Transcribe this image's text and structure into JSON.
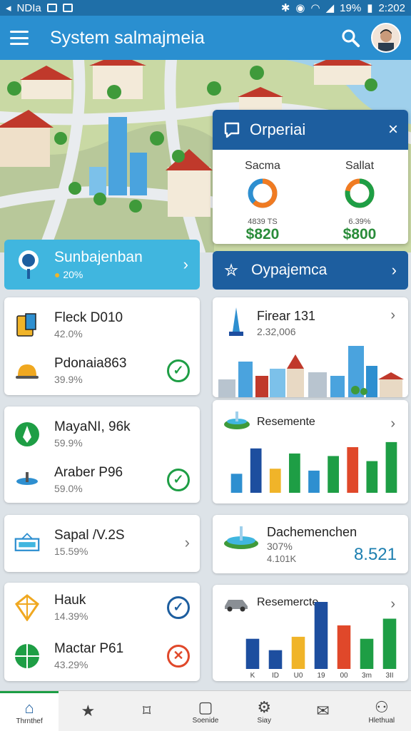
{
  "status_bar": {
    "carrier": "NDIa",
    "battery": "19%",
    "time": "2:202"
  },
  "app_bar": {
    "title": "System salmajmeia"
  },
  "popup": {
    "title": "Orperiai",
    "close": "×",
    "left": {
      "label": "Sacma",
      "sub": "4839 TS",
      "value": "$820",
      "ring_fraction": 0.62
    },
    "right": {
      "label": "Sallat",
      "sub": "6.39%",
      "value": "$800",
      "ring_fraction": 0.78
    }
  },
  "banner_left": {
    "title": "Sunbajenban",
    "sub": "20%"
  },
  "banner_right": {
    "title": "Oypajemca"
  },
  "left_cards": [
    {
      "rows": [
        {
          "name": "Fleck D010",
          "pct": "42.0%",
          "icon": "calculator-icon"
        },
        {
          "name": "Pdonaia863",
          "pct": "39.9%",
          "icon": "bell-icon",
          "status": "✓"
        }
      ]
    },
    {
      "rows": [
        {
          "name": "MayaNI, 96k",
          "pct": "59.9%",
          "icon": "leaf-icon"
        },
        {
          "name": "Araber P96",
          "pct": "59.0%",
          "icon": "fountain-icon",
          "status": "✓"
        }
      ]
    },
    {
      "rows": [
        {
          "name": "Sapal /V.2S",
          "pct": "15.59%",
          "icon": "sign-icon"
        }
      ]
    },
    {
      "rows": [
        {
          "name": "Hauk",
          "pct": "14.39%",
          "icon": "kite-icon",
          "status": "✓"
        },
        {
          "name": "Mactar P61",
          "pct": "43.29%",
          "icon": "globe-icon",
          "status": "✕"
        }
      ]
    }
  ],
  "right_cards": {
    "city": {
      "title": "Firear 131",
      "sub": "2.32,006"
    },
    "chart1": {
      "title": "Resemente",
      "chart_data": {
        "type": "bar",
        "values": [
          3,
          7,
          3.8,
          6.2,
          3.5,
          5.8,
          7.2,
          5,
          8
        ],
        "colors": [
          "#2e8fd0",
          "#1d4e9f",
          "#f0b429",
          "#1e9e45",
          "#2e8fd0",
          "#1e9e45",
          "#e0482a",
          "#1e9e45",
          "#1e9e45"
        ],
        "ylim": [
          0,
          9
        ]
      }
    },
    "stat": {
      "title": "Dachemenchen",
      "sub1": "307%",
      "sub2": "4.101K",
      "value": "8.521"
    },
    "chart2": {
      "title": "Resemercte",
      "chart_data": {
        "type": "bar",
        "categories": [
          "K",
          "ID",
          "U0",
          "19",
          "00",
          "3m",
          "3II"
        ],
        "values": [
          4.5,
          2.8,
          4.8,
          10,
          6.5,
          4.5,
          7.5
        ],
        "colors": [
          "#1d4e9f",
          "#1d4e9f",
          "#f0b429",
          "#1d4e9f",
          "#e0482a",
          "#1e9e45",
          "#1e9e45"
        ],
        "ylim": [
          0,
          10
        ]
      }
    }
  },
  "nav": [
    {
      "label": "Thrnthef",
      "icon": "home-icon",
      "active": true
    },
    {
      "label": "",
      "icon": "star-icon"
    },
    {
      "label": "",
      "icon": "bookmark-icon"
    },
    {
      "label": "Soenide",
      "icon": "square-icon"
    },
    {
      "label": "Siay",
      "icon": "gear-icon"
    },
    {
      "label": "",
      "icon": "mail-icon"
    },
    {
      "label": "Hlethual",
      "icon": "user-icon"
    }
  ]
}
